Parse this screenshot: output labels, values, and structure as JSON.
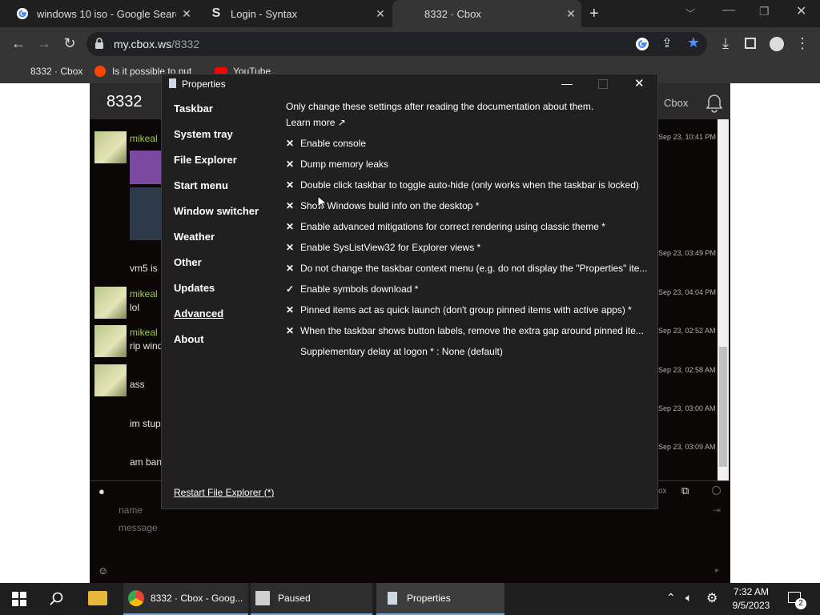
{
  "browser": {
    "tabs": [
      {
        "title": "windows 10 iso - Google Search",
        "close": "✕"
      },
      {
        "title": "Login - Syntax",
        "close": "✕"
      },
      {
        "title": "8332 · Cbox",
        "close": "✕"
      }
    ],
    "new_tab": "+",
    "url_host": "my.cbox.ws",
    "url_path": "/8332",
    "bookmarks": [
      "8332 · Cbox",
      "Is it possible to put",
      "YouTube"
    ]
  },
  "cbox": {
    "room_title": "8332",
    "header_link": "Cbox",
    "name_placeholder": "name",
    "message_placeholder": "message",
    "messages": [
      {
        "user": "mikeal",
        "text": "",
        "time": "Sep 23, 10:41 PM"
      },
      {
        "user": "",
        "text": "vm5 is",
        "time": "Sep 23, 03:49 PM"
      },
      {
        "user": "mikeal",
        "text": "lol",
        "time": "Sep 23, 04:04 PM"
      },
      {
        "user": "mikeal",
        "text": "rip wind",
        "time": "Sep 23, 02:52 AM"
      },
      {
        "user": "",
        "text": "ass",
        "time": "Sep 23, 02:58 AM"
      },
      {
        "user": "",
        "text": "im stup",
        "time": "Sep 23, 03:00 AM"
      },
      {
        "user": "",
        "text": "am ban",
        "time": "Sep 23, 03:09 AM"
      }
    ],
    "footer_label": "ox"
  },
  "dialog": {
    "title": "Properties",
    "nav": [
      "Taskbar",
      "System tray",
      "File Explorer",
      "Start menu",
      "Window switcher",
      "Weather",
      "Other",
      "Updates",
      "Advanced",
      "About"
    ],
    "selected_nav": "Advanced",
    "intro": "Only change these settings after reading the documentation about them.",
    "learn_more": "Learn more ↗",
    "options": [
      {
        "mark": "✕",
        "label": "Enable console"
      },
      {
        "mark": "✕",
        "label": "Dump memory leaks"
      },
      {
        "mark": "✕",
        "label": "Double click taskbar to toggle auto-hide (only works when the taskbar is locked)"
      },
      {
        "mark": "✕",
        "label": "Show Windows build info on the desktop *"
      },
      {
        "mark": "✕",
        "label": "Enable advanced mitigations for correct rendering using classic theme *"
      },
      {
        "mark": "✕",
        "label": "Enable SysListView32 for Explorer views *"
      },
      {
        "mark": "✕",
        "label": "Do not change the taskbar context menu (e.g. do not display the \"Properties\" ite..."
      },
      {
        "mark": "✓",
        "label": "Enable symbols download *"
      },
      {
        "mark": "✕",
        "label": "Pinned items act as quick launch (don't group pinned items with active apps) *"
      },
      {
        "mark": "✕",
        "label": "When the taskbar shows button labels, remove the extra gap around pinned ite..."
      }
    ],
    "delay": "Supplementary delay at logon * : None (default)",
    "restart_link": "Restart File Explorer (*)"
  },
  "taskbar": {
    "items": [
      "8332 · Cbox - Goog...",
      "Paused",
      "Properties"
    ],
    "time": "7:32 AM",
    "date": "9/5/2023",
    "notif_count": "2"
  },
  "colors": {
    "accent": "#4d90fe",
    "username": "#9dcf3a",
    "alt_username": "#3a44c9"
  }
}
